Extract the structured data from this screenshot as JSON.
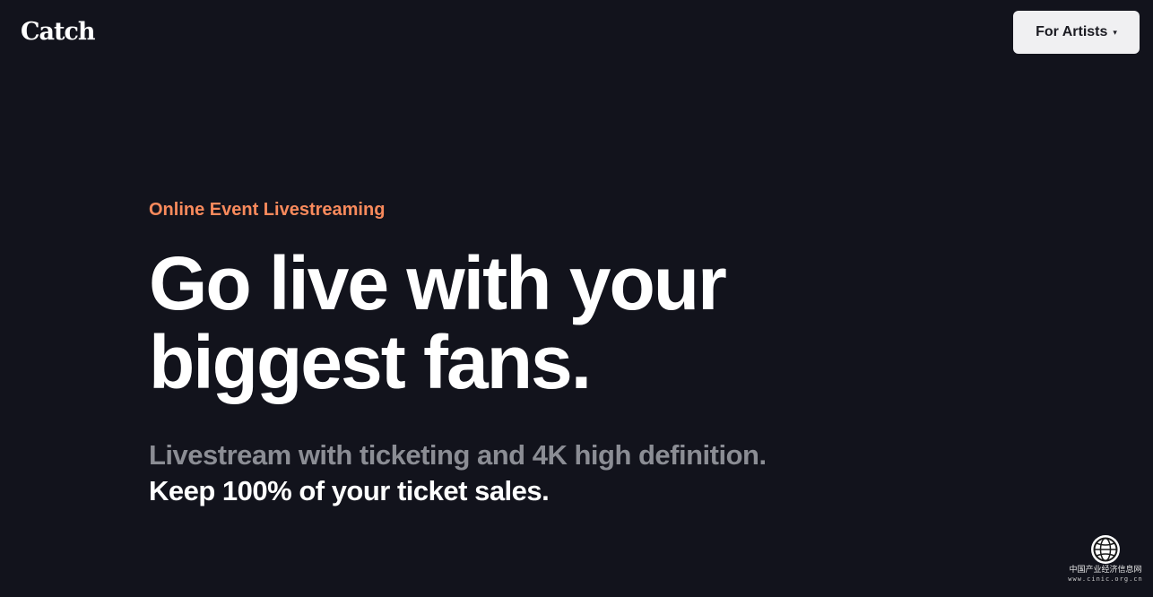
{
  "header": {
    "logo": "Catch",
    "artists_button": {
      "label": "For Artists",
      "caret": "▾"
    }
  },
  "hero": {
    "eyebrow": "Online Event Livestreaming",
    "headline": [
      "Go live with your",
      "biggest fans."
    ],
    "sub_gray": "Livestream with ticketing and 4K high definition.",
    "sub_white": "Keep 100% of your ticket sales."
  },
  "watermark": {
    "icon": "globe-seal-icon",
    "text": "中国产业经济信息网",
    "url": "www.cinic.org.cn"
  },
  "colors": {
    "background": "#12131c",
    "accent": "#f98a5c",
    "muted_text": "#8b8d94",
    "button_bg": "#f0f0f2"
  }
}
